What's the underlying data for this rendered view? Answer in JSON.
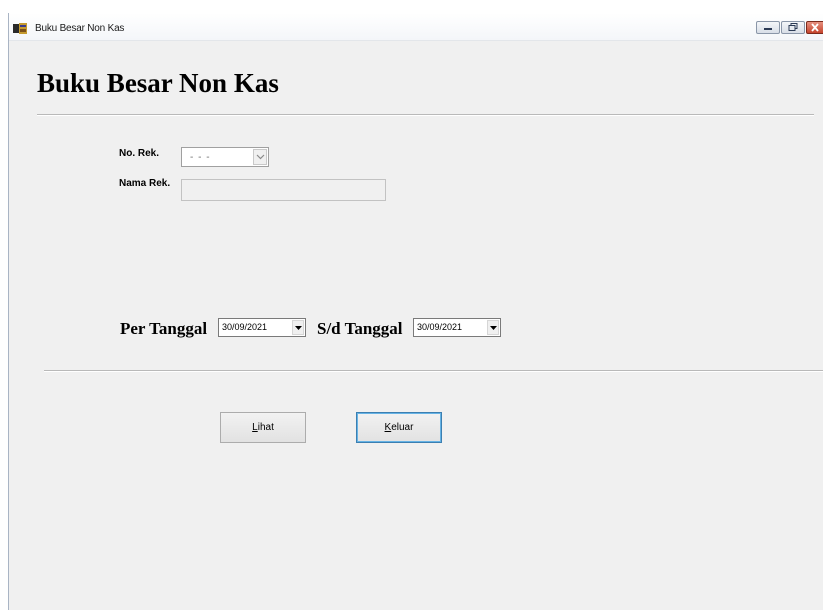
{
  "window": {
    "title": "Buku Besar Non Kas",
    "controls": {
      "minimize_icon": "minimize-icon",
      "maximize_icon": "maximize-icon",
      "close_icon": "close-icon"
    }
  },
  "heading": "Buku Besar Non Kas",
  "form": {
    "no_rek_label": "No. Rek.",
    "no_rek_value": "- - -",
    "nama_rek_label": "Nama Rek.",
    "nama_rek_value": ""
  },
  "dates": {
    "per_tanggal_label": "Per Tanggal",
    "per_tanggal_value": "30/09/2021",
    "sd_tanggal_label": "S/d Tanggal",
    "sd_tanggal_value": "30/09/2021"
  },
  "buttons": {
    "lihat": {
      "access_key": "L",
      "rest": "ihat"
    },
    "keluar": {
      "access_key": "K",
      "rest": "eluar"
    }
  },
  "colors": {
    "window_bg": "#f0f0f0",
    "close_button": "#c5432c",
    "focus_border": "#3c7fb1"
  }
}
